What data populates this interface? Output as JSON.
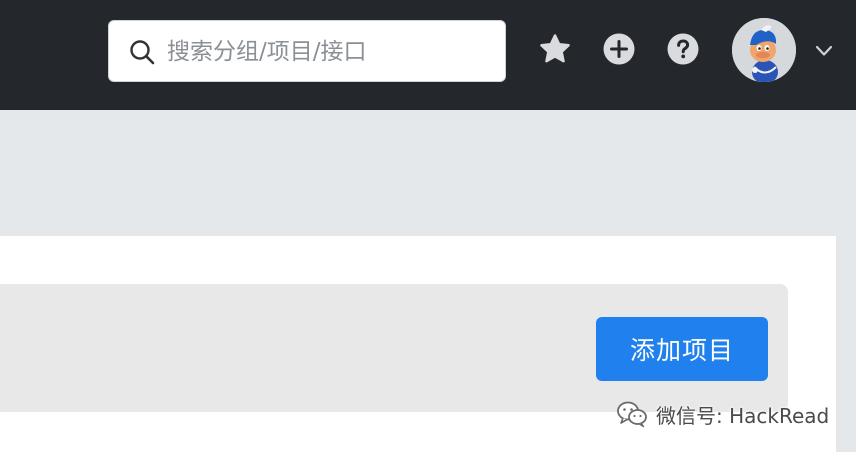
{
  "header": {
    "search": {
      "placeholder": "搜索分组/项目/接口",
      "value": ""
    },
    "icons": [
      "star-icon",
      "plus-circle-icon",
      "question-circle-icon",
      "chevron-down-icon"
    ],
    "colors": {
      "bar": "#24282d",
      "icon": "#d9dbde"
    }
  },
  "main": {
    "add_project_label": "添加项目",
    "colors": {
      "primary": "#1f80ee",
      "background": "#e5e8eb",
      "panel": "#ffffff",
      "toolbar": "#e8e8e8"
    }
  },
  "watermark": {
    "text": "微信号: HackRead"
  }
}
